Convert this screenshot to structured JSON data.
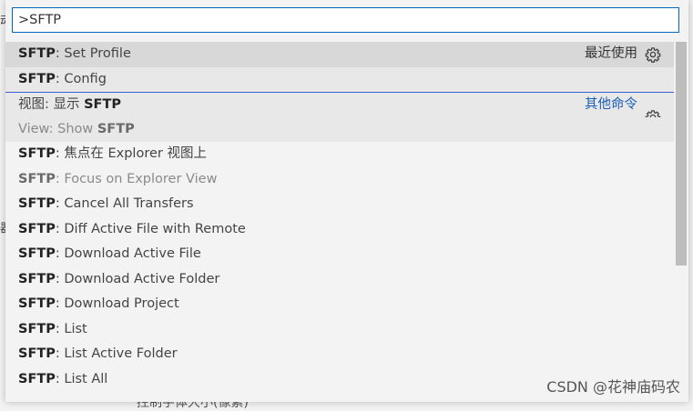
{
  "search": {
    "value": ">SFTP"
  },
  "items": [
    {
      "prefix": "SFTP",
      "sep": ": ",
      "text": "Set Profile",
      "tag": "最近使用"
    },
    {
      "prefix": "SFTP",
      "sep": ": ",
      "text": "Config"
    },
    {
      "prefix": "视图: 显示 ",
      "bold": "SFTP",
      "tag": "其他命令"
    },
    {
      "prefix": "View: Show ",
      "bold": "SFTP"
    },
    {
      "prefix": "SFTP",
      "sep": ": ",
      "text": "焦点在 Explorer 视图上"
    },
    {
      "prefix": "SFTP",
      "sep": ": ",
      "text": "Focus on Explorer View"
    },
    {
      "prefix": "SFTP",
      "sep": ": ",
      "text": "Cancel All Transfers"
    },
    {
      "prefix": "SFTP",
      "sep": ": ",
      "text": "Diff Active File with Remote"
    },
    {
      "prefix": "SFTP",
      "sep": ": ",
      "text": "Download Active File"
    },
    {
      "prefix": "SFTP",
      "sep": ": ",
      "text": "Download Active Folder"
    },
    {
      "prefix": "SFTP",
      "sep": ": ",
      "text": "Download Project"
    },
    {
      "prefix": "SFTP",
      "sep": ": ",
      "text": "List"
    },
    {
      "prefix": "SFTP",
      "sep": ": ",
      "text": "List Active Folder"
    },
    {
      "prefix": "SFTP",
      "sep": ": ",
      "text": "List All"
    }
  ],
  "background": {
    "left_glyph_1": "动",
    "left_glyph_2": "器",
    "bottom_text": "控制字体大小(像素)"
  },
  "watermark": "CSDN @花神庙码农",
  "icons": {
    "gear": "gear-icon"
  },
  "colors": {
    "accent": "#0066bf",
    "link": "#1a5fb4",
    "selected": "#d8d8d8"
  }
}
